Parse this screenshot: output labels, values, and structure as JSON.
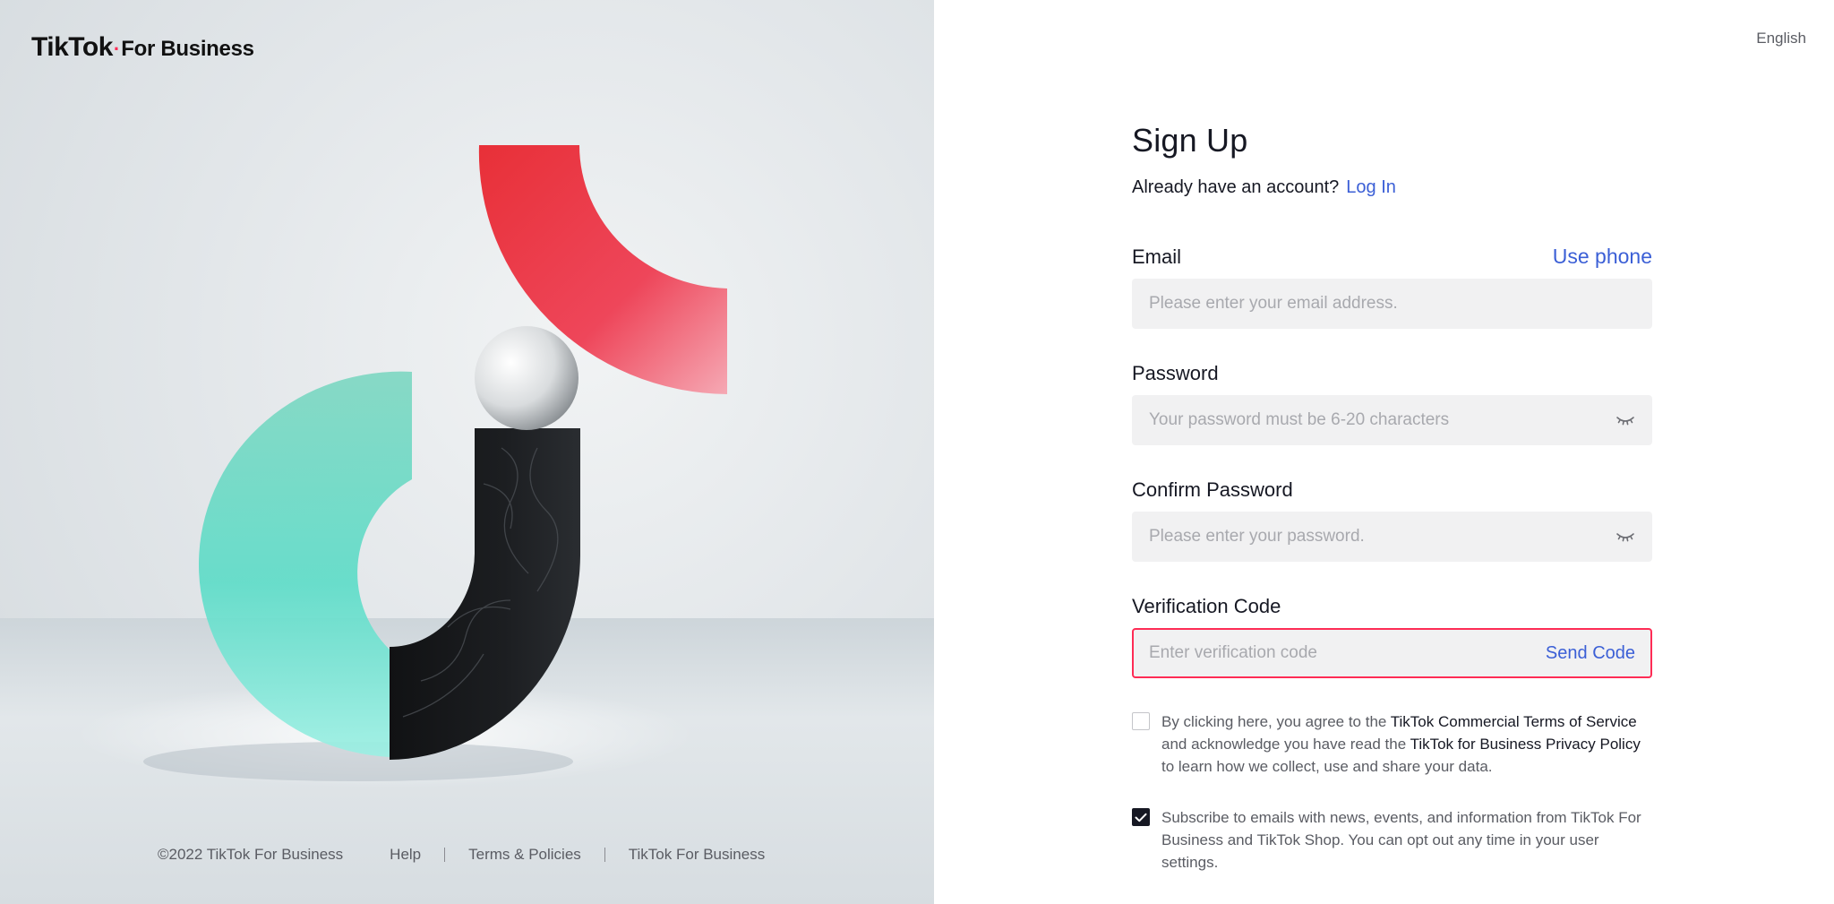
{
  "brand": {
    "wordmark": "TikTok",
    "dot": "·",
    "suffix": "For Business"
  },
  "header": {
    "language": "English"
  },
  "signup": {
    "title": "Sign Up",
    "already_text": "Already have an account?",
    "login_link": "Log In",
    "email": {
      "label": "Email",
      "switch_link": "Use phone",
      "placeholder": "Please enter your email address.",
      "value": ""
    },
    "password": {
      "label": "Password",
      "placeholder": "Your password must be 6-20 characters",
      "value": "",
      "toggle_icon": "eye-closed-icon"
    },
    "confirm_password": {
      "label": "Confirm Password",
      "placeholder": "Please enter your password.",
      "value": "",
      "toggle_icon": "eye-closed-icon"
    },
    "verification": {
      "label": "Verification Code",
      "placeholder": "Enter verification code",
      "value": "",
      "send_button": "Send Code"
    },
    "terms": {
      "checked": false,
      "text_1": "By clicking here, you agree to the ",
      "link_1": "TikTok Commercial Terms of Service",
      "text_2": " and acknowledge you have read the ",
      "link_2": "TikTok for Business Privacy Policy",
      "text_3": " to learn how we collect, use and share your data."
    },
    "subscribe": {
      "checked": true,
      "text": "Subscribe to emails with news, events, and information from TikTok For Business and TikTok Shop. You can opt out any time in your user settings."
    }
  },
  "footer": {
    "copyright": "©2022 TikTok For Business",
    "links": [
      "Help",
      "Terms & Policies",
      "TikTok For Business"
    ]
  },
  "colors": {
    "accent": "#3b5fd6",
    "error_border": "#fe2c55",
    "input_bg": "#f1f1f2",
    "text_primary": "#161823",
    "text_secondary": "#5a5c63"
  }
}
